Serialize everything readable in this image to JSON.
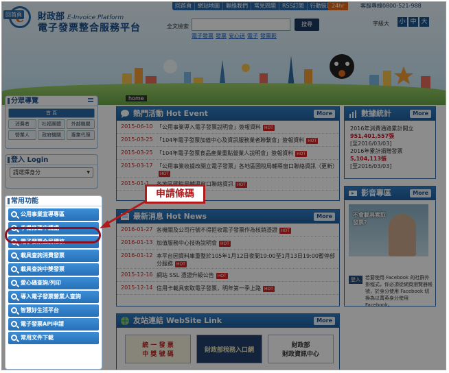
{
  "header": {
    "home_tab": "回首頁",
    "logo_letter": "e",
    "brand_ministry": "財政部",
    "brand_en": "E-Invoice Platform",
    "brand_cn": "電子發票整合服務平台",
    "topnav": [
      "回首頁",
      "網站地圖",
      "聯絡我們",
      "常見問題",
      "RSS訂閱",
      "行動裝置"
    ],
    "badge_24hr": "24hr",
    "hotline": "客服專線0800-521-988",
    "search_label": "全文檢索",
    "search_button": "搜尋",
    "quicklinks": [
      "電子發票",
      "發票",
      "安心送",
      "電子",
      "發票影"
    ],
    "fontsize_label": "字級大",
    "fontsize": [
      "小",
      "中",
      "大"
    ],
    "breadcrumb_home": "home"
  },
  "sidebar": {
    "category_title": "分眾導覽",
    "categories": [
      "首 頁",
      "消費者",
      "社福團體",
      "外部機關",
      "營業人",
      "政府機關",
      "專業代理"
    ],
    "login_title": "登入 Login",
    "identity_placeholder": "請選擇身分",
    "common_title": "常用功能",
    "common_items": [
      "公用事業宣導專區",
      "手機條碼申請處",
      "電子發票全民稽核",
      "載具查詢消費發票",
      "載具查詢中獎發票",
      "愛心碼查詢/列印",
      "導入電子發票營業人查詢",
      "智慧好生活平台",
      "電子發票API申請",
      "常用文件下載"
    ]
  },
  "callout": {
    "label": "申請條碼"
  },
  "hot_event": {
    "title": "熱門活動 Hot Event",
    "more": "More",
    "rows": [
      {
        "date": "2015-06-10",
        "text": "「公用事業導入電子發票說明會」簽報資料",
        "hot": "HOT"
      },
      {
        "date": "2015-03-25",
        "text": "「104年電子發票加值中心及資訊服務業者聯繫會」簽報資料",
        "hot": "HOT"
      },
      {
        "date": "2015-03-25",
        "text": "「104年電子發票食品產業重點營業人說明會」簽報資料",
        "hot": "HOT"
      },
      {
        "date": "2015-03-17",
        "text": "「公用事業收據改開立電子發票」各地區國稅局輔導窗口聯絡資訊（更新）",
        "hot": "HOT"
      },
      {
        "date": "2015-01-1",
        "text": "各地區國稅局輔導窗口聯絡資訊",
        "hot": "HOT"
      }
    ]
  },
  "news": {
    "title": "最新消息 Hot News",
    "more": "More",
    "rows": [
      {
        "date": "2016-01-27",
        "text": "各機關及公司行號不得拒收電子發票作為核銷憑證",
        "hot": "HOT"
      },
      {
        "date": "2016-01-13",
        "text": "加值服務中心技術說明會",
        "hot": "HOT"
      },
      {
        "date": "2016-01-12",
        "text": "本平台因資料庫重整於105年1月12日夜間19:00至1月13日19:00暫停部分服務",
        "hot": "HOT"
      },
      {
        "date": "2015-12-16",
        "text": "網站 SSL 憑證升級公告",
        "hot": "HOT"
      },
      {
        "date": "2015-12-14",
        "text": "信用卡載具索取電子發票，明年第一季上路",
        "hot": "HOT"
      }
    ]
  },
  "links": {
    "title": "友站連結 WebSite Link",
    "more": "More",
    "tiles": [
      "統 一 發 票\n中 獎 號 碼",
      "財政部稅務入口網",
      "財政部\n財政資訊中心"
    ]
  },
  "stats": {
    "title": "數據統計",
    "more": "More",
    "lines": [
      {
        "label": "2016年消費通路累計開立",
        "value": "951,401,557張",
        "date": "[至2016/03/03]"
      },
      {
        "label": "2016年累計捐贈發票",
        "value": "5,104,113張",
        "date": "[至2016/03/03]"
      }
    ]
  },
  "video": {
    "title": "影音專區",
    "more": "More",
    "caption": "不會載具索取\n發票？",
    "fb_login": "登入",
    "fb_text": "若要使用 Facebook 的社群外掛程式，你必須從網頁瀏覽器帳號，於身分使用 Facebook 切換為以菁英身分使用 Facebook。"
  },
  "colors": {
    "brand_blue": "#2a6aa8",
    "accent_orange": "#e36b1b",
    "date_red": "#b22222",
    "highlight_red": "#b11a1a"
  }
}
